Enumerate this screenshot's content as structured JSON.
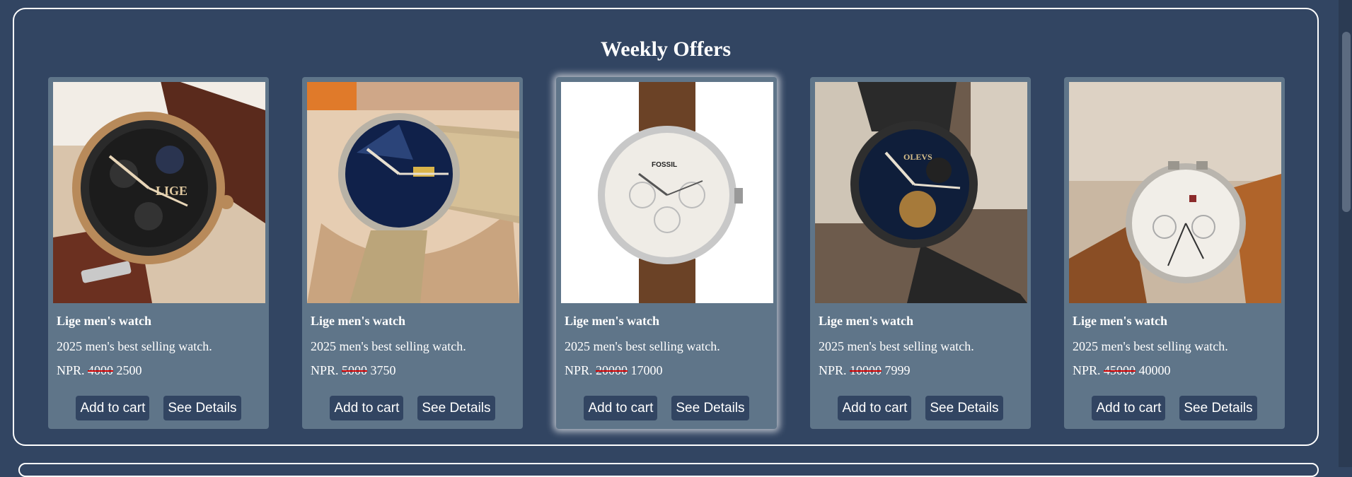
{
  "section": {
    "title": "Weekly Offers"
  },
  "products": [
    {
      "name": "Lige men's watch",
      "description": "2025 men's best selling watch.",
      "currency": "NPR.",
      "old_price": "4000",
      "new_price": "2500",
      "add_label": "Add to cart",
      "details_label": "See Details"
    },
    {
      "name": "Lige men's watch",
      "description": "2025 men's best selling watch.",
      "currency": "NPR.",
      "old_price": "5000",
      "new_price": "3750",
      "add_label": "Add to cart",
      "details_label": "See Details"
    },
    {
      "name": "Lige men's watch",
      "description": "2025 men's best selling watch.",
      "currency": "NPR.",
      "old_price": "20000",
      "new_price": "17000",
      "add_label": "Add to cart",
      "details_label": "See Details"
    },
    {
      "name": "Lige men's watch",
      "description": "2025 men's best selling watch.",
      "currency": "NPR.",
      "old_price": "10000",
      "new_price": "7999",
      "add_label": "Add to cart",
      "details_label": "See Details"
    },
    {
      "name": "Lige men's watch",
      "description": "2025 men's best selling watch.",
      "currency": "NPR.",
      "old_price": "45000",
      "new_price": "40000",
      "add_label": "Add to cart",
      "details_label": "See Details"
    }
  ],
  "colors": {
    "page_bg": "#324562",
    "card_bg": "#5f7589",
    "button_bg": "#324562",
    "strike": "#d00000"
  }
}
